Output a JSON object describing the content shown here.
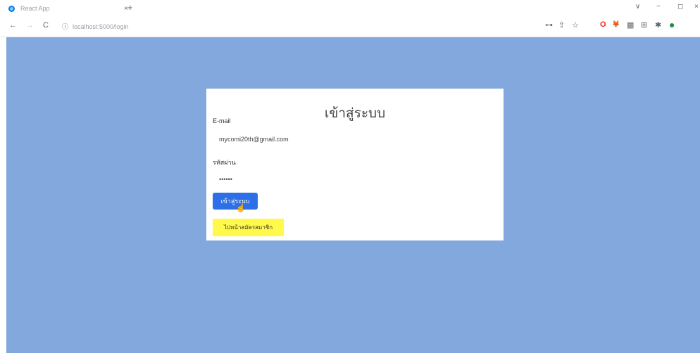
{
  "browser": {
    "tab": {
      "title": "React App",
      "close_icon": "×"
    },
    "new_tab_icon": "+",
    "window_controls": {
      "chevron": "∨",
      "minimize": "−",
      "restore": "◻",
      "close": "×"
    },
    "nav": {
      "back": "←",
      "forward": "→",
      "reload": "C"
    },
    "url": "localhost:5000/login",
    "url_info_icon": "ⓘ",
    "toolbar_icons": [
      "⊶",
      "⇪",
      "☆",
      "O",
      "🦊",
      "▦",
      "⊞",
      "✱",
      "●"
    ]
  },
  "page": {
    "background": "#82a8dd",
    "title": "เข้าสู่ระบบ",
    "email_label": "E-mail",
    "email_value": "mycomi20th@gmail.com",
    "password_label": "รหัสผ่าน",
    "password_value": "••••••",
    "login_button": "เข้าสู่ระบบ",
    "register_button": "ไปหน้าสมัครสมาชิก"
  }
}
